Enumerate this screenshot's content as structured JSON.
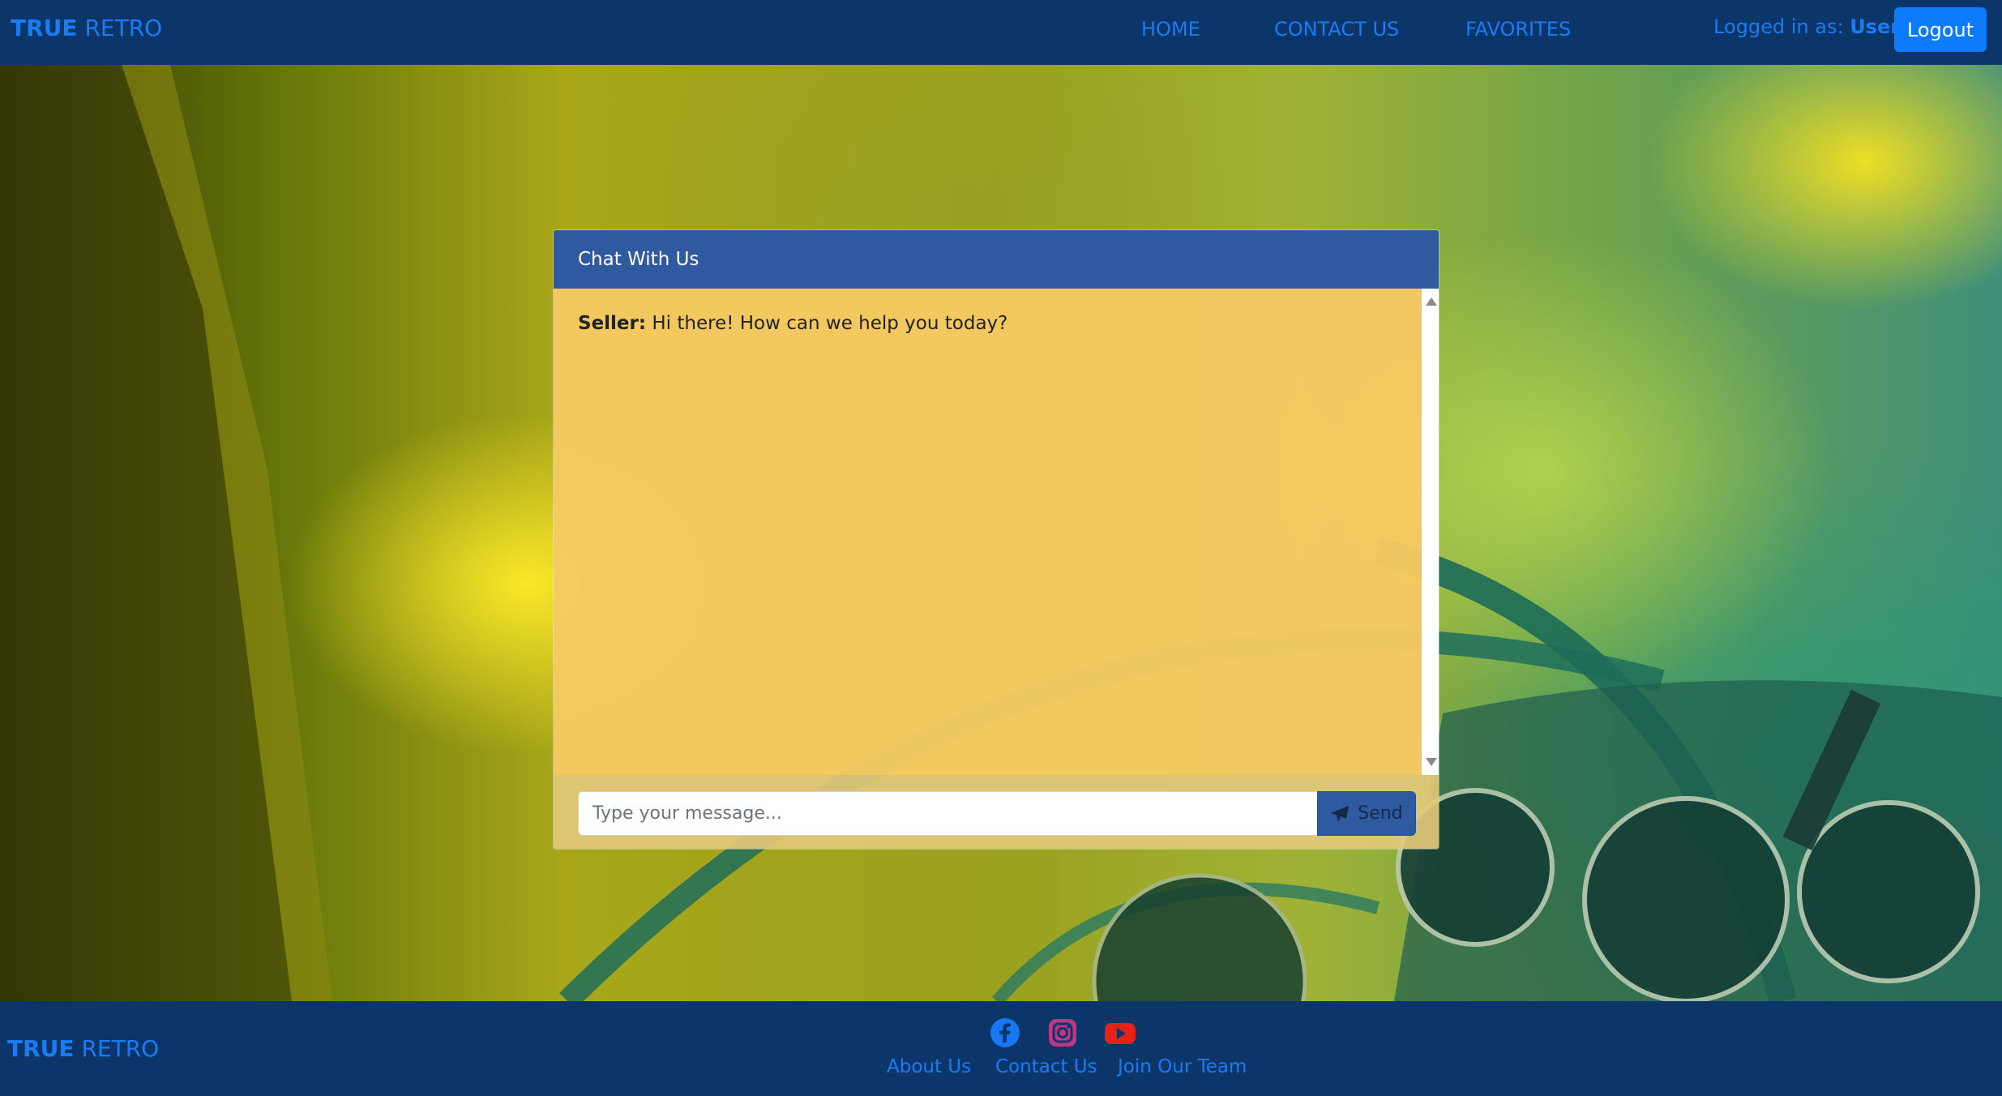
{
  "navbar": {
    "brand_bold": "TRUE",
    "brand_rest": "RETRO",
    "links": [
      "HOME",
      "CONTACT US",
      "FAVORITES"
    ],
    "logged_in_label": "Logged in as:",
    "logged_in_user": "User",
    "logout_label": "Logout"
  },
  "chat": {
    "title": "Chat With Us",
    "messages": [
      {
        "sender": "Seller:",
        "text": "Hi there! How can we help you today?"
      }
    ],
    "input_placeholder": "Type your message...",
    "send_label": "Send"
  },
  "footer": {
    "brand_bold": "TRUE",
    "brand_rest": "RETRO",
    "social_icons": [
      "facebook-icon",
      "instagram-icon",
      "youtube-icon"
    ],
    "links": [
      "About Us",
      "Contact Us",
      "Join Our Team"
    ]
  },
  "colors": {
    "navbar_bg": "#0c3569",
    "link": "#1a7cf5",
    "logout_bg": "#0d7bfb",
    "chat_header_bg": "#2f5a9f",
    "chat_body_bg": "#f6ca62",
    "facebook": "#1877f2",
    "instagram": "#c13584",
    "youtube": "#e62117"
  }
}
